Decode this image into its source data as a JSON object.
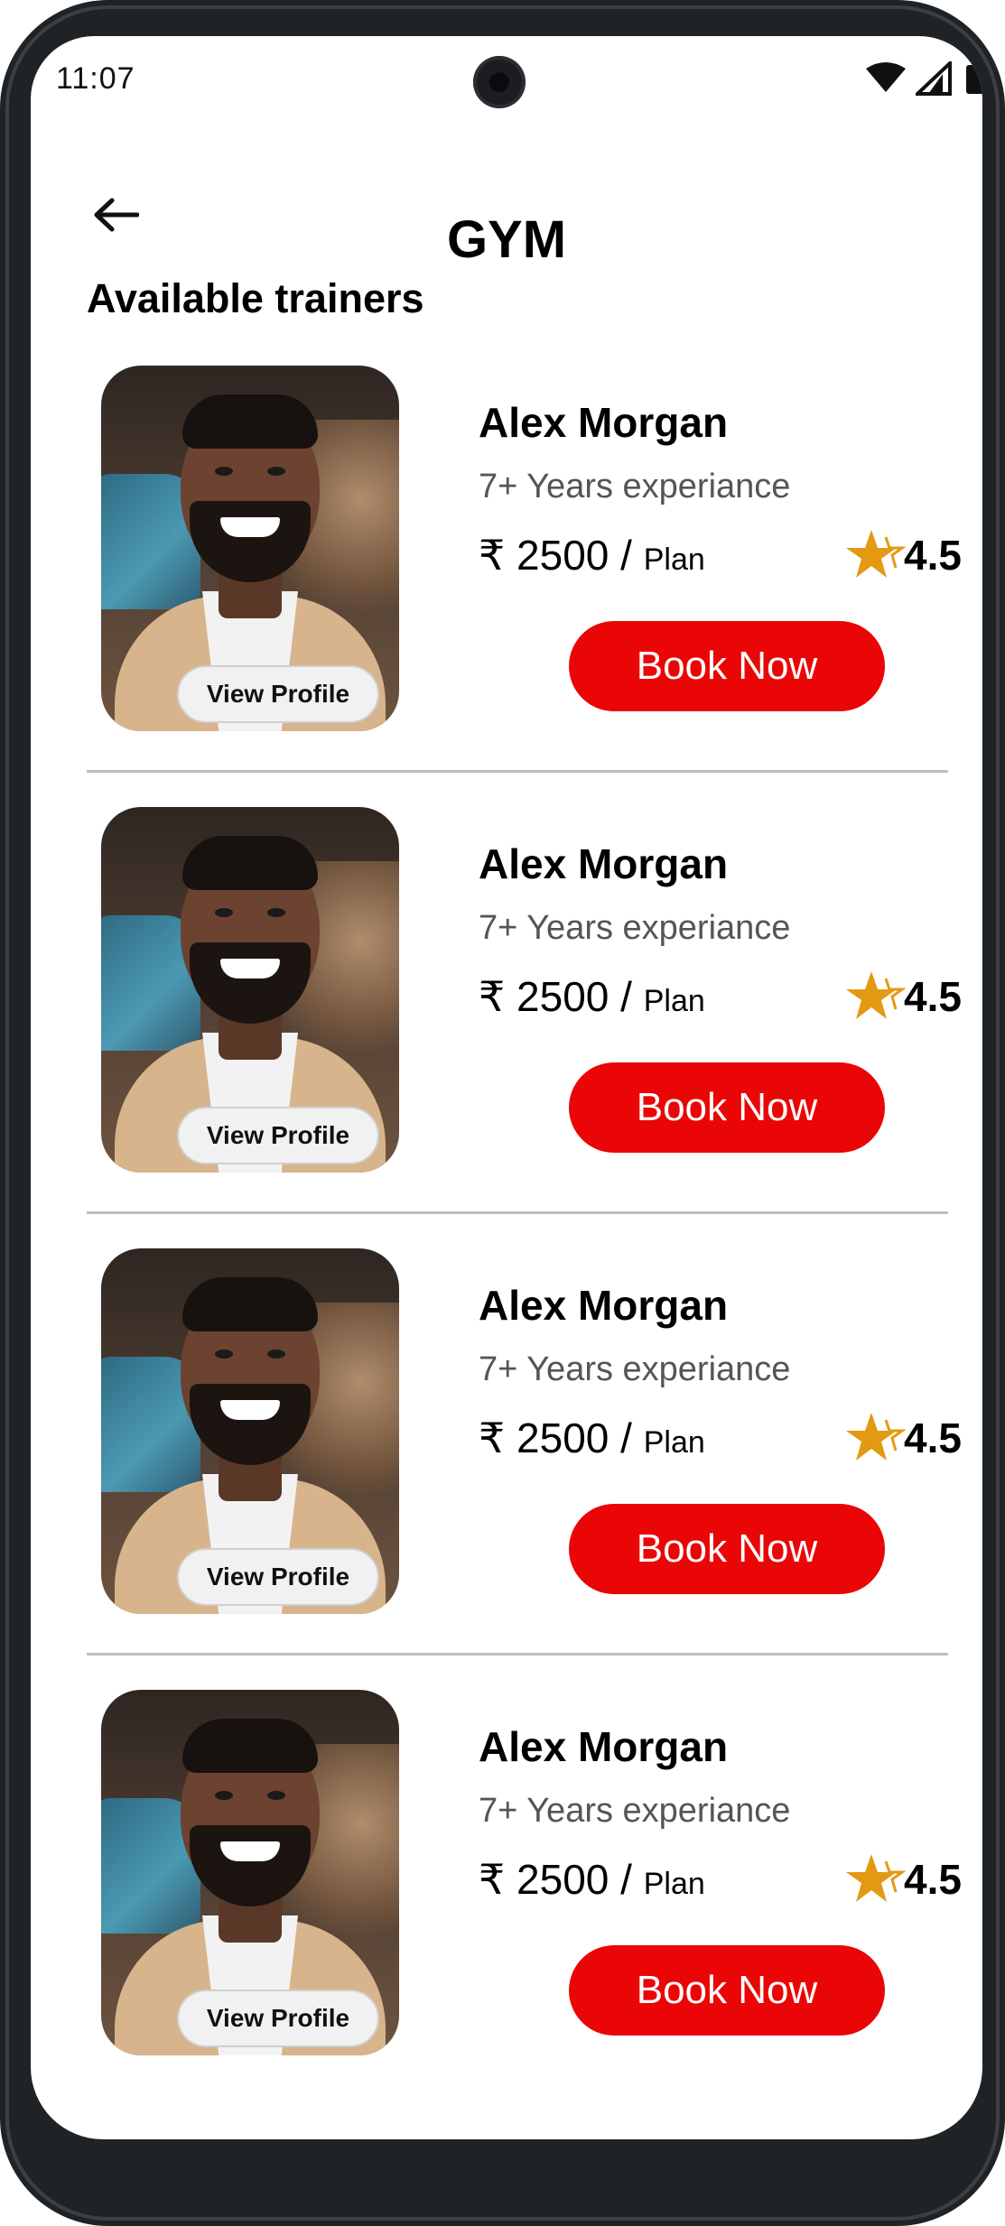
{
  "status_bar": {
    "time": "11:07"
  },
  "header": {
    "title": "GYM"
  },
  "section": {
    "heading": "Available trainers"
  },
  "colors": {
    "accent": "#ea0606",
    "star": "#e39a12"
  },
  "trainers": [
    {
      "name": "Alex Morgan",
      "experience": "7+ Years experiance",
      "price": "₹ 2500 /",
      "price_unit": "Plan",
      "rating": "4.5",
      "view_profile_label": "View Profile",
      "book_label": "Book Now"
    },
    {
      "name": "Alex Morgan",
      "experience": "7+ Years experiance",
      "price": "₹ 2500 /",
      "price_unit": "Plan",
      "rating": "4.5",
      "view_profile_label": "View Profile",
      "book_label": "Book Now"
    },
    {
      "name": "Alex Morgan",
      "experience": "7+ Years experiance",
      "price": "₹ 2500 /",
      "price_unit": "Plan",
      "rating": "4.5",
      "view_profile_label": "View Profile",
      "book_label": "Book Now"
    },
    {
      "name": "Alex Morgan",
      "experience": "7+ Years experiance",
      "price": "₹ 2500 /",
      "price_unit": "Plan",
      "rating": "4.5",
      "view_profile_label": "View Profile",
      "book_label": "Book Now"
    }
  ]
}
